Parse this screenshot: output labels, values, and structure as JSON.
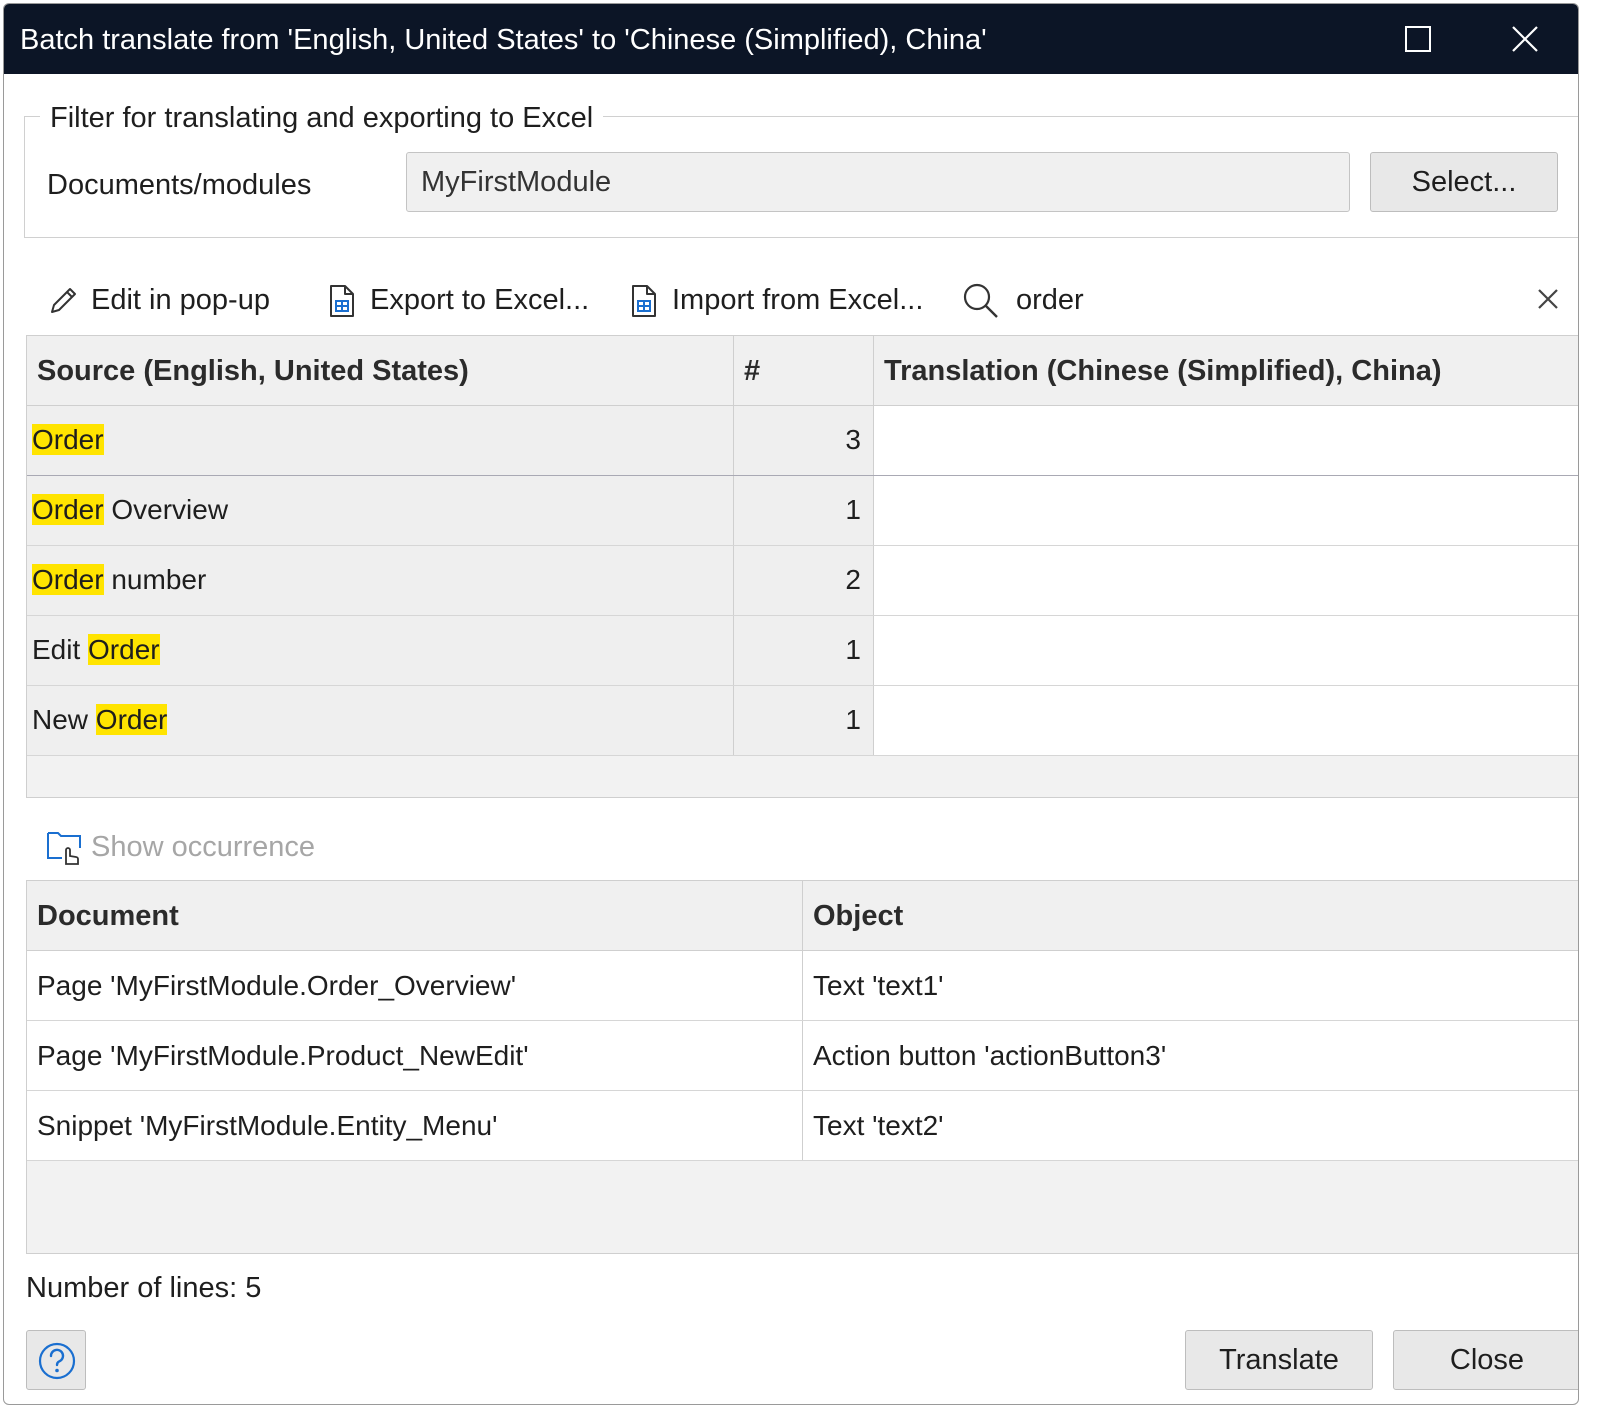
{
  "window": {
    "title": "Batch translate from 'English, United States' to 'Chinese (Simplified), China'"
  },
  "filter": {
    "legend": "Filter for translating and exporting to Excel",
    "documents_label": "Documents/modules",
    "documents_value": "MyFirstModule",
    "select_button": "Select..."
  },
  "toolbar": {
    "edit_popup": "Edit in pop-up",
    "export_excel": "Export to Excel...",
    "import_excel": "Import from Excel...",
    "search_value": "order"
  },
  "translations": {
    "headers": {
      "source": "Source (English, United States)",
      "count": "#",
      "translation": "Translation (Chinese (Simplified), China)"
    },
    "rows": [
      {
        "pre": "",
        "match": "Order",
        "post": "",
        "count": "3",
        "translation": ""
      },
      {
        "pre": "",
        "match": "Order",
        "post": " Overview",
        "count": "1",
        "translation": ""
      },
      {
        "pre": "",
        "match": "Order",
        "post": " number",
        "count": "2",
        "translation": ""
      },
      {
        "pre": "Edit ",
        "match": "Order",
        "post": "",
        "count": "1",
        "translation": ""
      },
      {
        "pre": "New ",
        "match": "Order",
        "post": "",
        "count": "1",
        "translation": ""
      }
    ]
  },
  "occurrence": {
    "show_button": "Show occurrence",
    "headers": {
      "document": "Document",
      "object": "Object"
    },
    "rows": [
      {
        "document": "Page 'MyFirstModule.Order_Overview'",
        "object": "Text 'text1'"
      },
      {
        "document": "Page 'MyFirstModule.Product_NewEdit'",
        "object": "Action button 'actionButton3'"
      },
      {
        "document": "Snippet 'MyFirstModule.Entity_Menu'",
        "object": "Text 'text2'"
      }
    ]
  },
  "status": {
    "number_of_lines": "Number of lines: 5"
  },
  "footer": {
    "translate_button": "Translate",
    "close_button": "Close"
  },
  "colors": {
    "titlebar": "#0c1526",
    "highlight": "#ffe400",
    "accent": "#1a6fd0"
  },
  "icons": [
    "maximize-icon",
    "close-icon",
    "pencil-icon",
    "excel-export-icon",
    "excel-import-icon",
    "search-icon",
    "clear-icon",
    "show-occurrence-icon",
    "help-icon"
  ]
}
